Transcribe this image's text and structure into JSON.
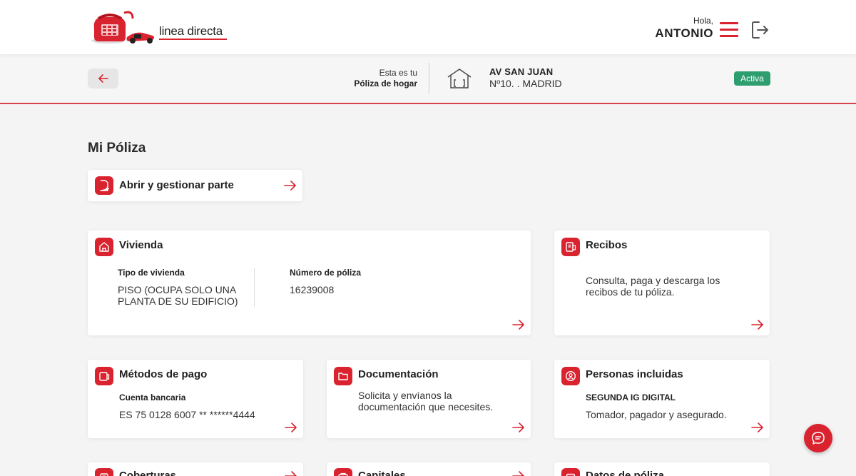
{
  "header": {
    "logo_text": "linea directa",
    "greeting": "Hola,",
    "user_name": "ANTONIO"
  },
  "subheader": {
    "policy_line1": "Esta es tu",
    "policy_line2": "Póliza de hogar",
    "address_line1": "AV SAN JUAN",
    "address_line2": "Nº10. . MADRID",
    "status": "Activa"
  },
  "main": {
    "title": "Mi Póliza",
    "claim_card": {
      "title": "Abrir y gestionar parte"
    },
    "vivienda": {
      "title": "Vivienda",
      "type_label": "Tipo de vivienda",
      "type_value": "PISO (OCUPA SOLO UNA PLANTA DE SU EDIFICIO)",
      "policy_label": "Número de póliza",
      "policy_value": "16239008"
    },
    "recibos": {
      "title": "Recibos",
      "text": "Consulta, paga y descarga los recibos de tu póliza."
    },
    "metodos_pago": {
      "title": "Métodos de pago",
      "label": "Cuenta bancaria",
      "value": "ES 75 0128 6007 ** ******4444"
    },
    "documentacion": {
      "title": "Documentación",
      "text": "Solicita y envíanos la documentación que necesites."
    },
    "personas": {
      "title": "Personas incluidas",
      "label": "SEGUNDA IG DIGITAL",
      "value": "Tomador, pagador y asegurado."
    },
    "coberturas": {
      "title": "Coberturas"
    },
    "capitales": {
      "title": "Capitales"
    },
    "datos_poliza": {
      "title": "Datos de póliza"
    }
  },
  "colors": {
    "brand_red": "#d9232f",
    "status_green": "#2e9e6f"
  },
  "icons": {
    "menu": "hamburger-icon",
    "logout": "logout-icon",
    "back": "arrow-left-icon",
    "house": "house-icon",
    "chat": "chat-bubble-icon"
  }
}
